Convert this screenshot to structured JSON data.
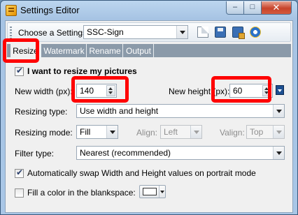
{
  "window": {
    "title": "Settings Editor",
    "minimize": "–",
    "maximize": "□",
    "close": "✕"
  },
  "toolbar": {
    "choose_label": "Choose a Settings:",
    "settings_value": "SSC-Sign",
    "icons": [
      "new-file-icon",
      "save-icon",
      "save-as-icon",
      "settings-icon"
    ]
  },
  "tabs": [
    {
      "label": "Resize",
      "active": true
    },
    {
      "label": "Watermark",
      "active": false
    },
    {
      "label": "Rename",
      "active": false
    },
    {
      "label": "Output",
      "active": false
    }
  ],
  "resize": {
    "enable_label": "I want to resize my pictures",
    "enable_checked": true,
    "width_label": "New width (px):",
    "width_value": "140",
    "height_label": "New height (px):",
    "height_value": "60",
    "type_label": "Resizing type:",
    "type_value": "Use width and height",
    "mode_label": "Resizing mode:",
    "mode_value": "Fill",
    "align_label": "Align:",
    "align_value": "Left",
    "valign_label": "Valign:",
    "valign_value": "Top",
    "filter_label": "Filter type:",
    "filter_value": "Nearest (recommended)",
    "swap_label": "Automatically swap Width and Height values on portrait mode",
    "swap_checked": true,
    "fill_label": "Fill a color in the blankspace:",
    "fill_checked": false
  },
  "colors": {
    "highlight": "#ff0000",
    "tab_strip": "#8b9aa9",
    "fill_color": "#ffffff"
  }
}
